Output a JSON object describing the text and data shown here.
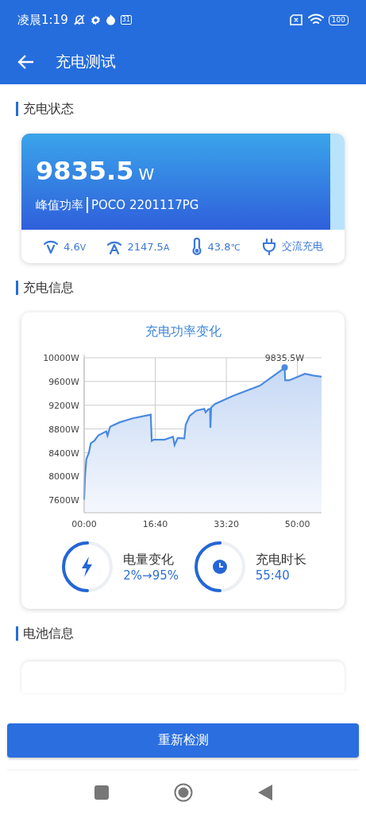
{
  "status_bar": {
    "time": "凌晨1:19",
    "calendar_day": "31",
    "battery": "100"
  },
  "app_bar": {
    "title": "充电测试"
  },
  "sections": [
    {
      "title": "充电状态"
    },
    {
      "title": "充电信息"
    },
    {
      "title": "电池信息"
    }
  ],
  "power_card": {
    "value": "9835.5",
    "unit": "W",
    "label": "峰值功率",
    "device": "POCO 2201117PG",
    "stats": [
      {
        "kind": "voltage",
        "value": "4.6",
        "unit": "V"
      },
      {
        "kind": "current",
        "value": "2147.5",
        "unit": "A"
      },
      {
        "kind": "temperature",
        "value": "43.8",
        "unit": "℃"
      },
      {
        "kind": "plug",
        "value": "交流充电"
      }
    ]
  },
  "chart_card": {
    "chart_data": {
      "type": "area",
      "title": "充电功率变化",
      "xlim": [
        0,
        3340
      ],
      "ylim": [
        7390,
        10000
      ],
      "xticks": [
        {
          "value": 0,
          "label": "00:00"
        },
        {
          "value": 1000,
          "label": "16:40"
        },
        {
          "value": 2000,
          "label": "33:20"
        },
        {
          "value": 3000,
          "label": "50:00"
        }
      ],
      "yticks": [
        {
          "value": 7600,
          "label": "7600W"
        },
        {
          "value": 8000,
          "label": "8000W"
        },
        {
          "value": 8400,
          "label": "8400W"
        },
        {
          "value": 8800,
          "label": "8800W"
        },
        {
          "value": 9200,
          "label": "9200W"
        },
        {
          "value": 9600,
          "label": "9600W"
        },
        {
          "value": 10000,
          "label": "10000W"
        }
      ],
      "x": [
        0,
        11,
        30,
        67,
        93,
        142,
        198,
        310,
        328,
        366,
        496,
        683,
        937,
        951,
        981,
        1131,
        1250,
        1272,
        1317,
        1410,
        1429,
        1485,
        1578,
        1690,
        1709,
        1746,
        1772,
        1776,
        1787,
        1840,
        2101,
        2474,
        2810,
        2821,
        2828,
        2884,
        3108,
        3220,
        3340
      ],
      "grid": true,
      "series": [
        {
          "color": "#4a8ae0",
          "values": [
            7610,
            7980,
            8290,
            8400,
            8560,
            8600,
            8690,
            8760,
            8690,
            8840,
            8910,
            8980,
            9040,
            8600,
            8620,
            8620,
            8670,
            8530,
            8650,
            8640,
            8870,
            9020,
            9110,
            9140,
            9080,
            9130,
            9140,
            8820,
            9160,
            9220,
            9360,
            9530,
            9820,
            9836,
            9620,
            9620,
            9730,
            9700,
            9680
          ]
        }
      ],
      "annotations": [
        {
          "x": 2821,
          "y": 9836,
          "text": "9835.5W"
        }
      ]
    },
    "summary": [
      {
        "kind": "battery",
        "label": "电量变化",
        "value": "2%→95%",
        "level": 0.5
      },
      {
        "kind": "time",
        "label": "充电时长",
        "value": "55:40",
        "level": 0.5
      }
    ]
  },
  "button": {
    "label": "重新检测"
  }
}
